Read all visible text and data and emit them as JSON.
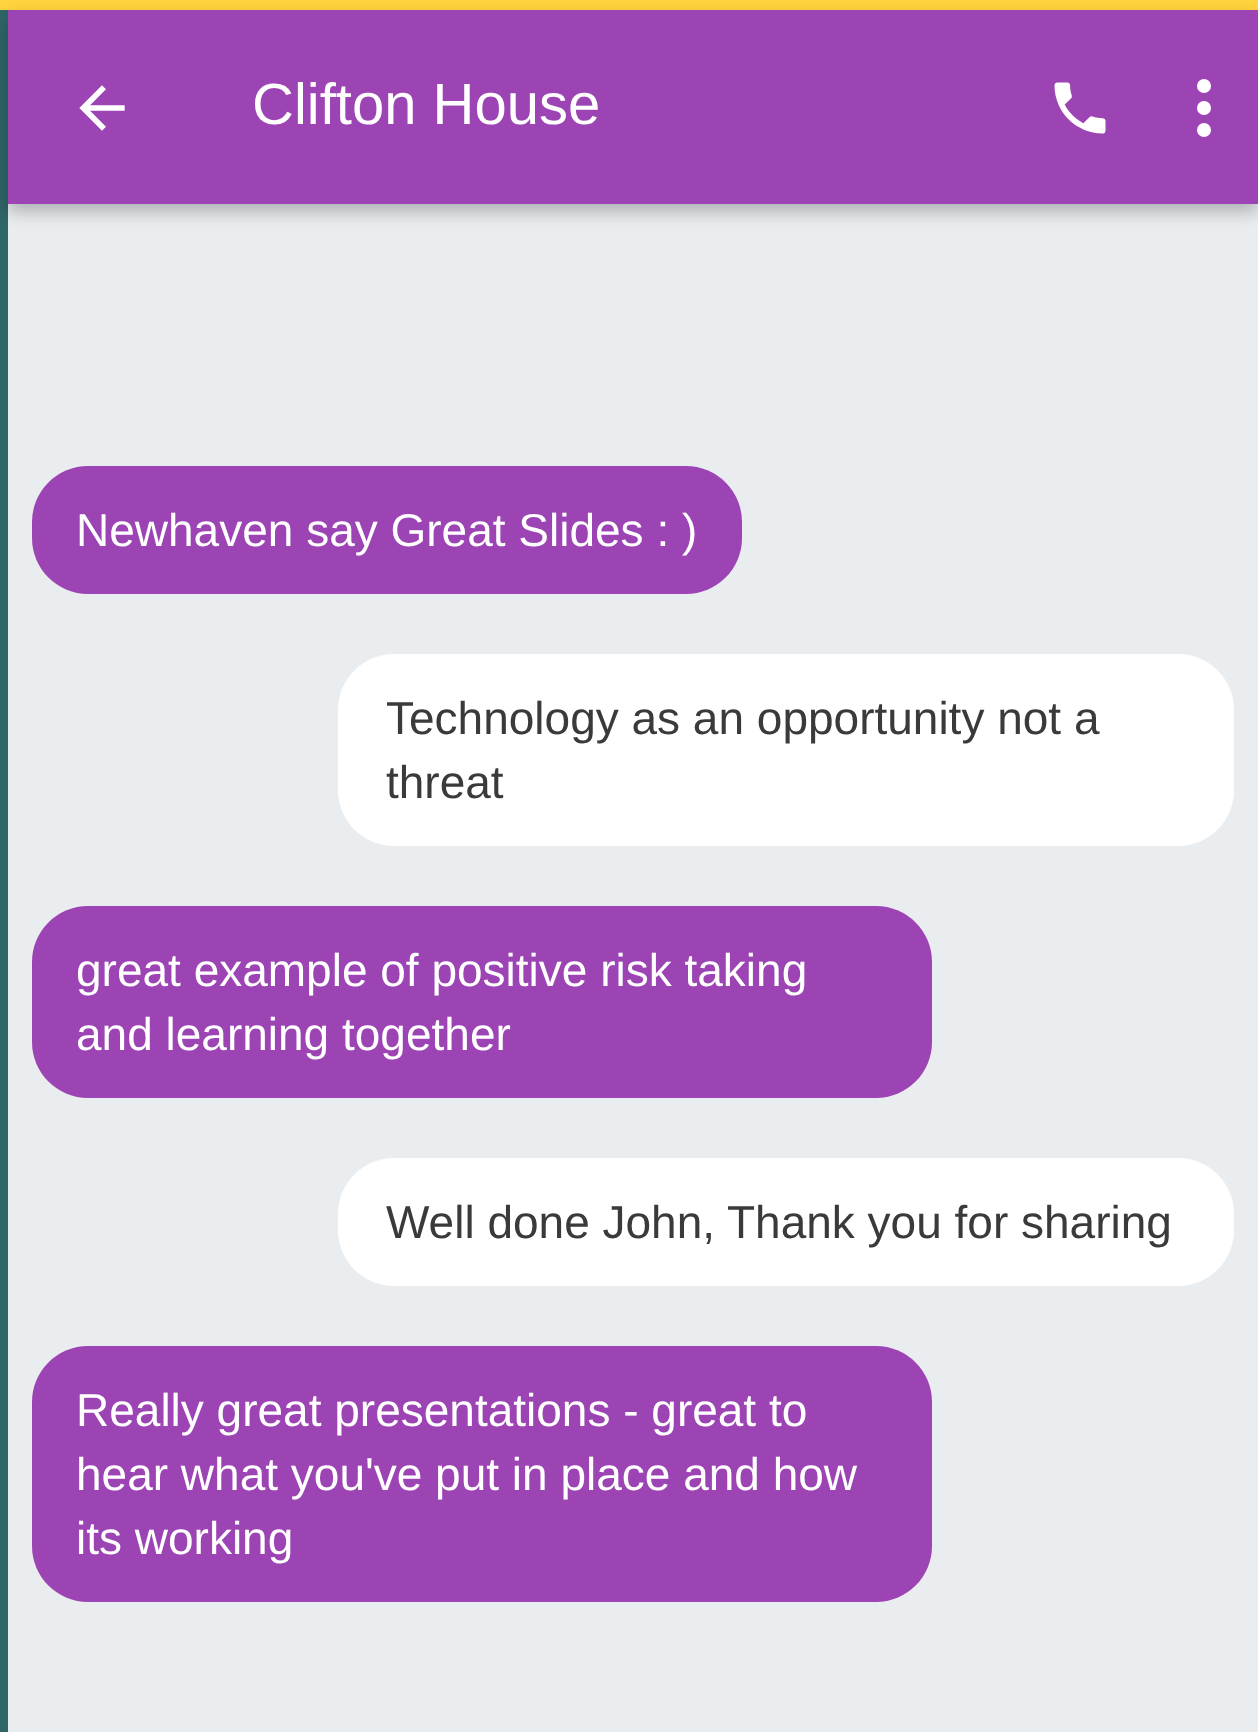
{
  "header": {
    "title": "Clifton House"
  },
  "messages": [
    {
      "kind": "received",
      "text": "Newhaven say Great Slides : )"
    },
    {
      "kind": "sent",
      "text": "Technology as an opportunity not a threat"
    },
    {
      "kind": "received",
      "text": "great example of positive risk taking and learning together"
    },
    {
      "kind": "sent",
      "text": "Well done John, Thank you for sharing"
    },
    {
      "kind": "received",
      "text": "Really great presentations - great to hear what you've put in place and how its working"
    }
  ]
}
